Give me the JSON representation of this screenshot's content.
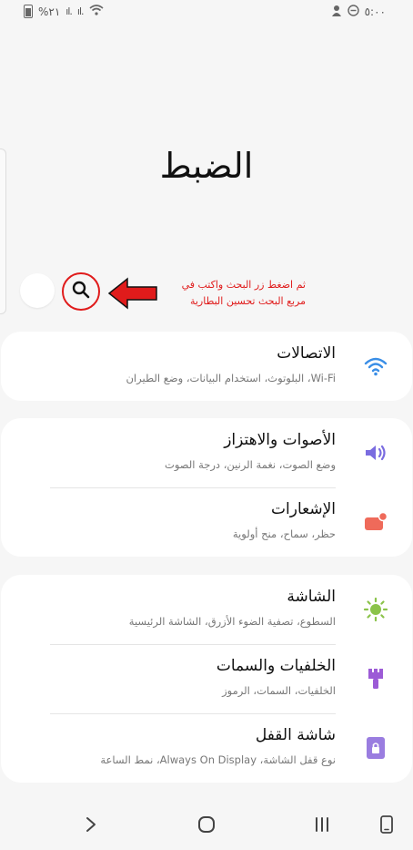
{
  "status_bar": {
    "battery_text": "%٢١",
    "signal1": "ıl.",
    "signal2": "ıl.",
    "time": "٥:٠٠"
  },
  "page": {
    "title": "الضبط"
  },
  "annotation": {
    "line1": "ثم اضغط زر البحث واكتب في",
    "line2": "مربع البحث تحسين البطارية"
  },
  "groups": [
    {
      "items": [
        {
          "title": "الاتصالات",
          "subtitle": "Wi-Fi، البلوتوث، استخدام البيانات، وضع الطيران",
          "icon": "wifi-icon",
          "color": "#3a8ee6"
        }
      ]
    },
    {
      "items": [
        {
          "title": "الأصوات والاهتزاز",
          "subtitle": "وضع الصوت، نغمة الرنين، درجة الصوت",
          "icon": "volume-icon",
          "color": "#7a6ce0"
        },
        {
          "title": "الإشعارات",
          "subtitle": "حظر، سماح، منح أولوية",
          "icon": "notifications-icon",
          "color": "#ef6a5a"
        }
      ]
    },
    {
      "items": [
        {
          "title": "الشاشة",
          "subtitle": "السطوع، تصفية الضوء الأزرق، الشاشة الرئيسية",
          "icon": "brightness-icon",
          "color": "#8bc34a"
        },
        {
          "title": "الخلفيات والسمات",
          "subtitle": "الخلفيات، السمات، الرموز",
          "icon": "themes-brush-icon",
          "color": "#9c5bd6"
        },
        {
          "title": "شاشة القفل",
          "subtitle": "نوع قفل الشاشة، Always On Display، نمط الساعة",
          "icon": "lock-screen-icon",
          "color": "#9a7de0"
        }
      ]
    }
  ]
}
